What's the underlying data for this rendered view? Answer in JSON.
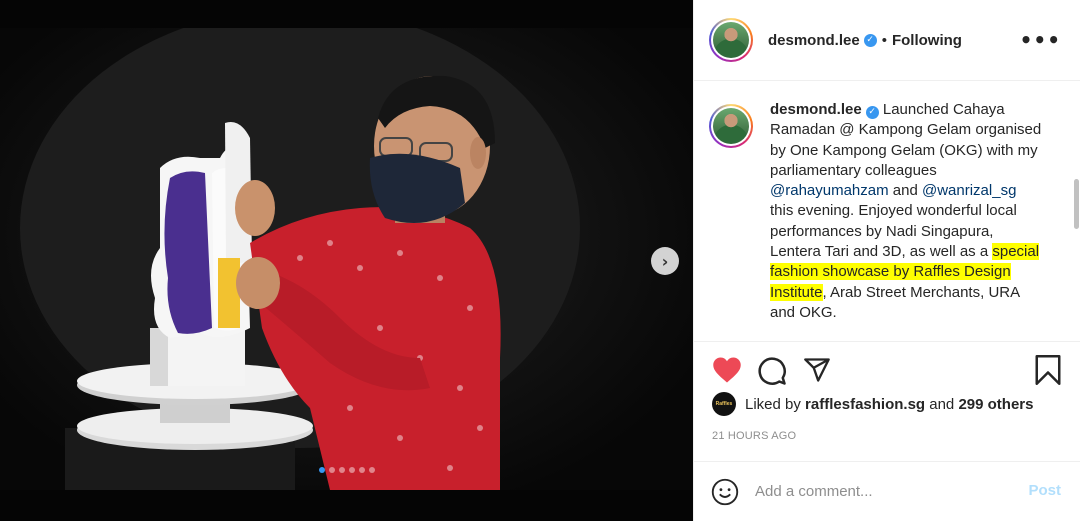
{
  "post": {
    "username": "desmond.lee",
    "separator": "•",
    "follow_status": "Following",
    "more_icon": "more-horizontal-icon",
    "verified_icon": "verified-check-icon"
  },
  "caption": {
    "username": "desmond.lee",
    "text_1": "Launched Cahaya Ramadan @ Kampong Gelam organised by One Kampong Gelam (OKG) with my parliamentary colleagues ",
    "mention_1": "@rahayumahzam",
    "text_2": " and ",
    "mention_2": "@wanrizal_sg",
    "text_3": " this evening. Enjoyed wonderful local performances by Nadi Singapura, Lentera Tari and 3D, as well as a ",
    "highlight": "special fashion showcase by Raffles Design Institute",
    "text_4": ", Arab Street Merchants, URA and OKG."
  },
  "actions": {
    "like_icon": "heart-filled-icon",
    "comment_icon": "comment-icon",
    "share_icon": "share-icon",
    "save_icon": "bookmark-icon",
    "like_color": "#ed4956"
  },
  "likes": {
    "prefix": "Liked by ",
    "user": "rafflesfashion.sg",
    "middle": " and ",
    "others": "299 others",
    "liker_avatar_text": "Raffles"
  },
  "timestamp": "21 HOURS AGO",
  "comment": {
    "placeholder": "Add a comment...",
    "post_label": "Post",
    "emoji_icon": "emoji-icon"
  },
  "carousel": {
    "next_icon": "chevron-right-icon",
    "slide_count": 6,
    "active_slide": 1
  }
}
